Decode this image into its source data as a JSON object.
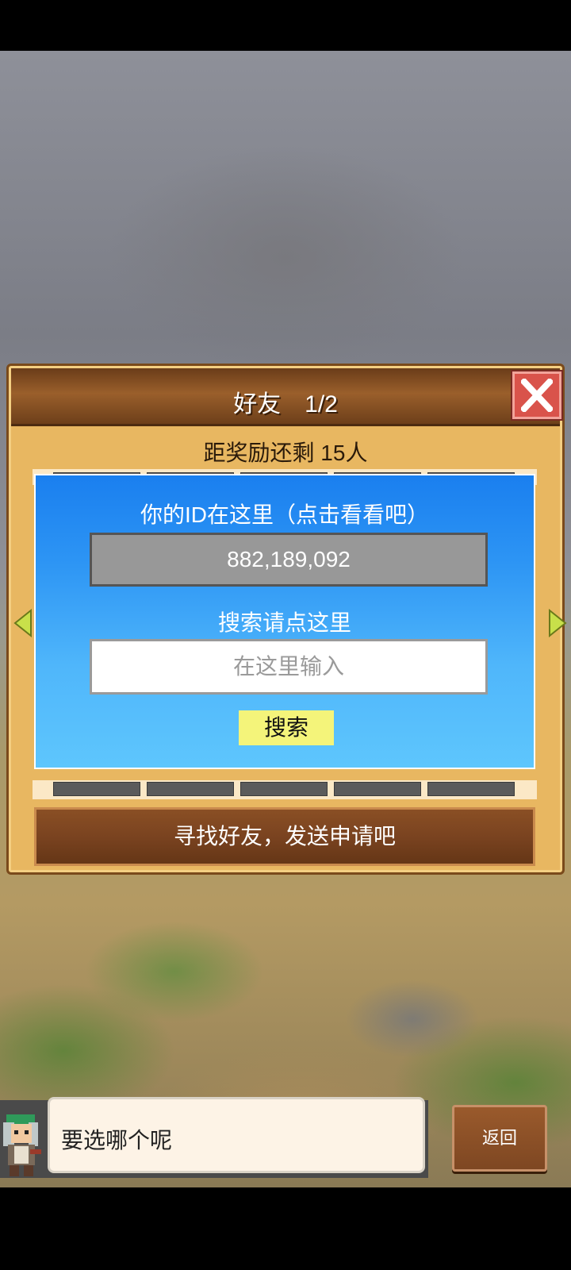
{
  "dialog": {
    "title": "好友　1/2",
    "reward_text": "距奖励还剩 15人",
    "your_id_label": "你的ID在这里（点击看看吧）",
    "your_id_value": "882,189,092",
    "search_label": "搜索请点这里",
    "search_placeholder": "在这里输入",
    "search_button": "搜索",
    "find_friends_button": "寻找好友，发送申请吧"
  },
  "bottom_bar": {
    "speech_text": "要选哪个呢",
    "back_button": "返回"
  },
  "colors": {
    "panel_wood": "#e8b761",
    "title_bar_brown": "#7a4320",
    "blue_panel": "#2d95f4",
    "close_red": "#d9534b",
    "search_button_yellow": "#f4f47a",
    "arrow_green": "#c8e04a"
  },
  "icons": {
    "close": "close-icon",
    "prev_page": "arrow-left-icon",
    "next_page": "arrow-right-icon",
    "character": "character-avatar"
  }
}
